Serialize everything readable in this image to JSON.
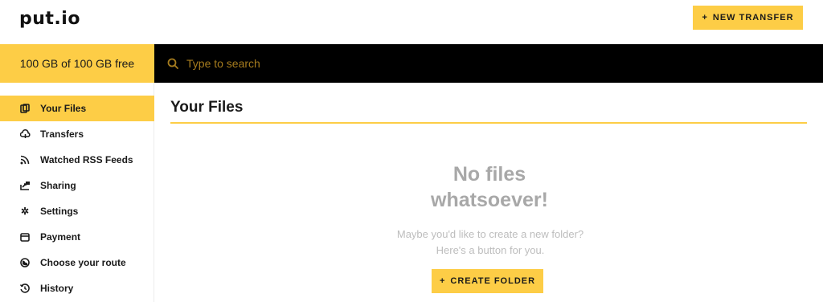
{
  "brand": {
    "logo_text": "put.io",
    "accent_color": "#fdcd46"
  },
  "header": {
    "new_transfer_label": "NEW TRANSFER",
    "new_transfer_icon": "plus-icon"
  },
  "quota": {
    "text": "100 GB of 100 GB free"
  },
  "search": {
    "placeholder": "Type to search",
    "value": "",
    "icon": "search-icon"
  },
  "sidebar": {
    "items": [
      {
        "label": "Your Files",
        "icon": "files-icon",
        "active": true
      },
      {
        "label": "Transfers",
        "icon": "cloud-transfer-icon",
        "active": false
      },
      {
        "label": "Watched RSS Feeds",
        "icon": "rss-icon",
        "active": false
      },
      {
        "label": "Sharing",
        "icon": "share-icon",
        "active": false
      },
      {
        "label": "Settings",
        "icon": "gear-icon",
        "active": false
      },
      {
        "label": "Payment",
        "icon": "card-icon",
        "active": false
      },
      {
        "label": "Choose your route",
        "icon": "globe-icon",
        "active": false
      },
      {
        "label": "History",
        "icon": "history-icon",
        "active": false
      }
    ]
  },
  "main": {
    "title": "Your Files",
    "empty_state": {
      "heading": "No files whatsoever!",
      "message": "Maybe you'd like to create a new folder? Here's a button for you.",
      "button_label": "CREATE FOLDER",
      "button_icon": "plus-icon"
    }
  }
}
